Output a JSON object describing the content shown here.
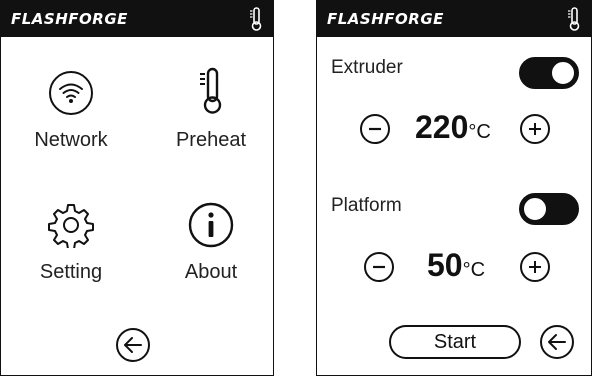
{
  "left_screen": {
    "brand": "FLASHFORGE",
    "tiles": {
      "network": {
        "label": "Network"
      },
      "preheat": {
        "label": "Preheat"
      },
      "setting": {
        "label": "Setting"
      },
      "about": {
        "label": "About"
      }
    },
    "icons": [
      "thermometer-icon",
      "wifi-icon",
      "thermometer-icon",
      "gear-icon",
      "info-icon",
      "back-arrow-icon"
    ]
  },
  "right_screen": {
    "brand": "FLASHFORGE",
    "extruder": {
      "label": "Extruder",
      "toggle": "on",
      "value": "220",
      "unit": "°C"
    },
    "platform": {
      "label": "Platform",
      "toggle": "off",
      "value": "50",
      "unit": "°C"
    },
    "start_label": "Start",
    "icons": [
      "thermometer-icon",
      "minus-icon",
      "plus-icon",
      "back-arrow-icon"
    ]
  },
  "colors": {
    "background": "#ffffff",
    "bar": "#111111",
    "accent": "#111111"
  }
}
